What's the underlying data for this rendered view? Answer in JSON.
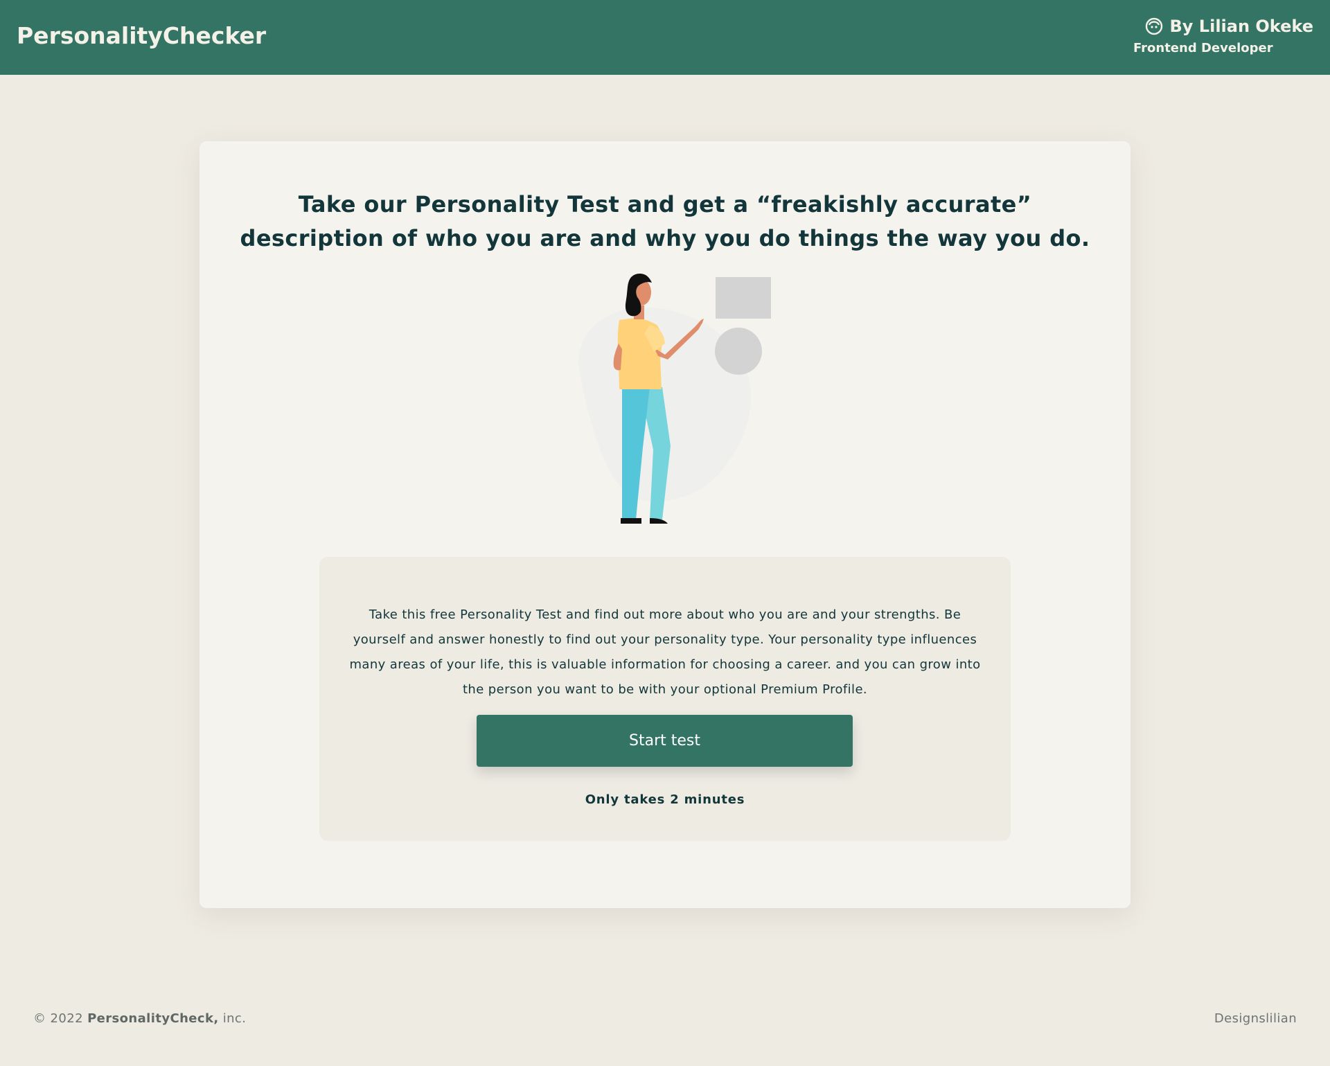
{
  "header": {
    "brand": "PersonalityChecker",
    "author_name": "By Lilian Okeke",
    "author_role": "Frontend Developer",
    "author_icon": "user-circle-icon",
    "background_color": "#347464"
  },
  "hero": {
    "headline": "Take our Personality Test and get a “freakishly accurate” description of who you are and why you do things the way you do."
  },
  "intro": {
    "description": "Take this free Personality Test and find out more about who you are and your strengths. Be yourself and answer honestly to find out your personality type. Your personality type influences many areas of your life, this is valuable information for choosing a career. and you can grow into the person you want to be with your optional Premium Profile.",
    "start_button_label": "Start test",
    "duration_note": "Only takes 2 minutes"
  },
  "footer": {
    "copyright_prefix": "© 2022",
    "company_name": "PersonalityCheck,",
    "copyright_suffix": "inc.",
    "designer_credit": "Designslilian"
  },
  "colors": {
    "accent": "#347464",
    "page_background": "#eeebe3",
    "card_background": "#f5f3ee",
    "text_dark": "#12363a"
  }
}
